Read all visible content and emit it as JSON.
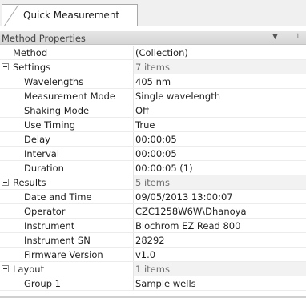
{
  "tab": {
    "label": "Quick Measurement"
  },
  "header": {
    "title": "Method Properties",
    "dropdown_glyph": "▼",
    "pin_glyph": "⊥",
    "icons": [
      "chevron-down-icon",
      "pin-icon"
    ]
  },
  "rows": {
    "method": {
      "name": "Method",
      "value": "(Collection)"
    },
    "settings": {
      "name": "Settings",
      "value": "7 items"
    },
    "wavelengths": {
      "name": "Wavelengths",
      "value": "405 nm"
    },
    "measurement_mode": {
      "name": "Measurement Mode",
      "value": "Single wavelength"
    },
    "shaking_mode": {
      "name": "Shaking Mode",
      "value": "Off"
    },
    "use_timing": {
      "name": "Use Timing",
      "value": "True"
    },
    "delay": {
      "name": "Delay",
      "value": "00:00:05"
    },
    "interval": {
      "name": "Interval",
      "value": "00:00:05"
    },
    "duration": {
      "name": "Duration",
      "value": "00:00:05 (1)"
    },
    "results": {
      "name": "Results",
      "value": "5 items"
    },
    "date_time": {
      "name": "Date and Time",
      "value": "09/05/2013 13:00:07"
    },
    "operator": {
      "name": "Operator",
      "value": "CZC1258W6W\\Dhanoya"
    },
    "instrument": {
      "name": "Instrument",
      "value": "Biochrom EZ Read 800"
    },
    "instrument_sn": {
      "name": "Instrument SN",
      "value": "28292"
    },
    "firmware": {
      "name": "Firmware Version",
      "value": "v1.0"
    },
    "layout": {
      "name": "Layout",
      "value": "1 items"
    },
    "group1": {
      "name": "Group 1",
      "value": "Sample wells"
    }
  }
}
